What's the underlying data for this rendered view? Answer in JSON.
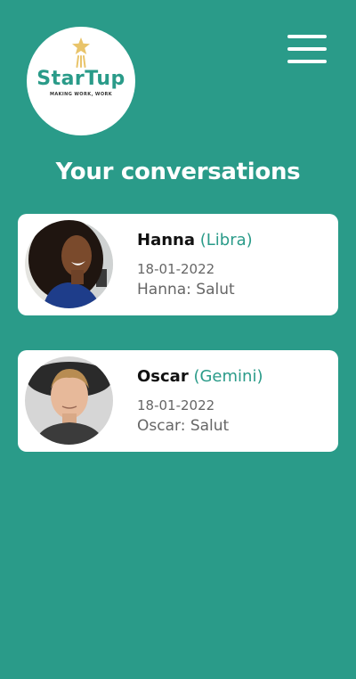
{
  "logo": {
    "title": "StarTup",
    "tagline": "MAKING WORK, WORK"
  },
  "header": {
    "menu_icon": "hamburger-menu-icon"
  },
  "page": {
    "title": "Your conversations"
  },
  "conversations": [
    {
      "name": "Hanna",
      "sign": "(Libra)",
      "date": "18-01-2022",
      "preview": "Hanna: Salut"
    },
    {
      "name": "Oscar",
      "sign": "(Gemini)",
      "date": "18-01-2022",
      "preview": "Oscar: Salut"
    }
  ],
  "colors": {
    "background": "#2a9b89",
    "accent": "#2a9b89",
    "star": "#e9c46a",
    "card": "#ffffff"
  }
}
